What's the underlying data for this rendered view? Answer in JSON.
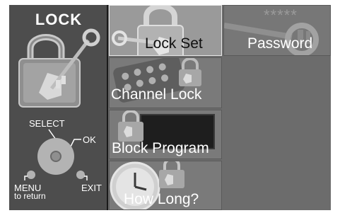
{
  "left_panel": {
    "title": "LOCK",
    "remote": {
      "select_label": "SELECT",
      "ok_label": "OK",
      "menu_label": "MENU",
      "menu_sub_label": "to return",
      "exit_label": "EXIT"
    }
  },
  "menu": {
    "lock_set": "Lock Set",
    "password": "Password",
    "password_mask": "*****",
    "channel_lock": "Channel Lock",
    "block_program": "Block Program",
    "how_long": "How Long?"
  },
  "selected_item": "Lock Set",
  "icons": [
    "padlock-key-icon",
    "dial-pad-icon",
    "key-icon",
    "keypad-icon",
    "screen-icon",
    "clock-icon",
    "remote-icon"
  ]
}
